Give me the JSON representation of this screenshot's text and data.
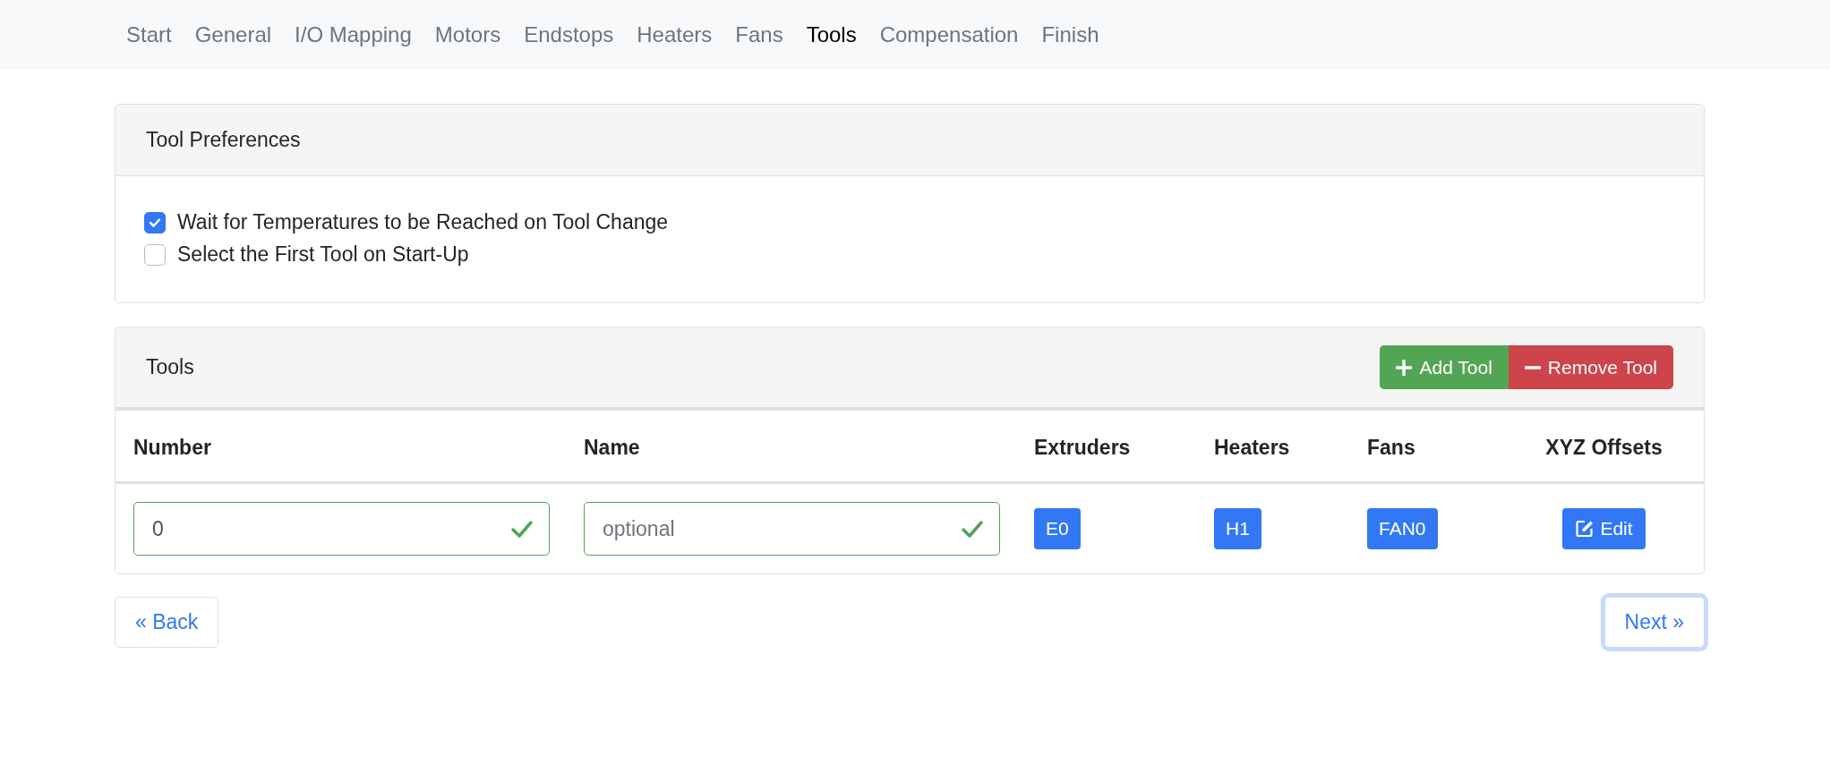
{
  "nav": [
    {
      "label": "Start",
      "selected": false
    },
    {
      "label": "General",
      "selected": false
    },
    {
      "label": "I/O Mapping",
      "selected": false
    },
    {
      "label": "Motors",
      "selected": false
    },
    {
      "label": "Endstops",
      "selected": false
    },
    {
      "label": "Heaters",
      "selected": false
    },
    {
      "label": "Fans",
      "selected": false
    },
    {
      "label": "Tools",
      "selected": true
    },
    {
      "label": "Compensation",
      "selected": false
    },
    {
      "label": "Finish",
      "selected": false
    }
  ],
  "preferences": {
    "title": "Tool Preferences",
    "options": [
      {
        "label": "Wait for Temperatures to be Reached on Tool Change",
        "checked": true
      },
      {
        "label": "Select the First Tool on Start-Up",
        "checked": false
      }
    ]
  },
  "tools": {
    "title": "Tools",
    "add_button": "Add Tool",
    "remove_button": "Remove Tool",
    "columns": [
      "Number",
      "Name",
      "Extruders",
      "Heaters",
      "Fans",
      "XYZ Offsets"
    ],
    "rows": [
      {
        "number": {
          "value": "0",
          "valid": true
        },
        "name": {
          "placeholder": "optional",
          "valid": true
        },
        "extruders": "E0",
        "heaters": "H1",
        "fans": "FAN0",
        "offsets_button": "Edit"
      }
    ]
  },
  "back_button": {
    "label": "« Back",
    "focused": false
  },
  "next_button": {
    "label": "Next »",
    "focused": true
  }
}
